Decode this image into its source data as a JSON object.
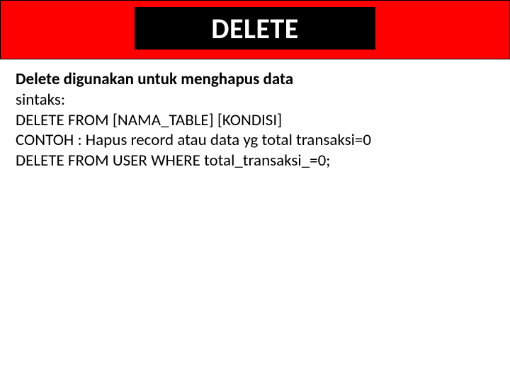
{
  "header": {
    "title": "DELETE"
  },
  "body": {
    "desc": "Delete digunakan untuk menghapus data",
    "line1": "sintaks:",
    "line2": "DELETE FROM [NAMA_TABLE] [KONDISI]",
    "line3": "CONTOH :  Hapus record atau data yg total transaksi=0",
    "line4": "DELETE FROM USER WHERE total_transaksi_=0;"
  }
}
